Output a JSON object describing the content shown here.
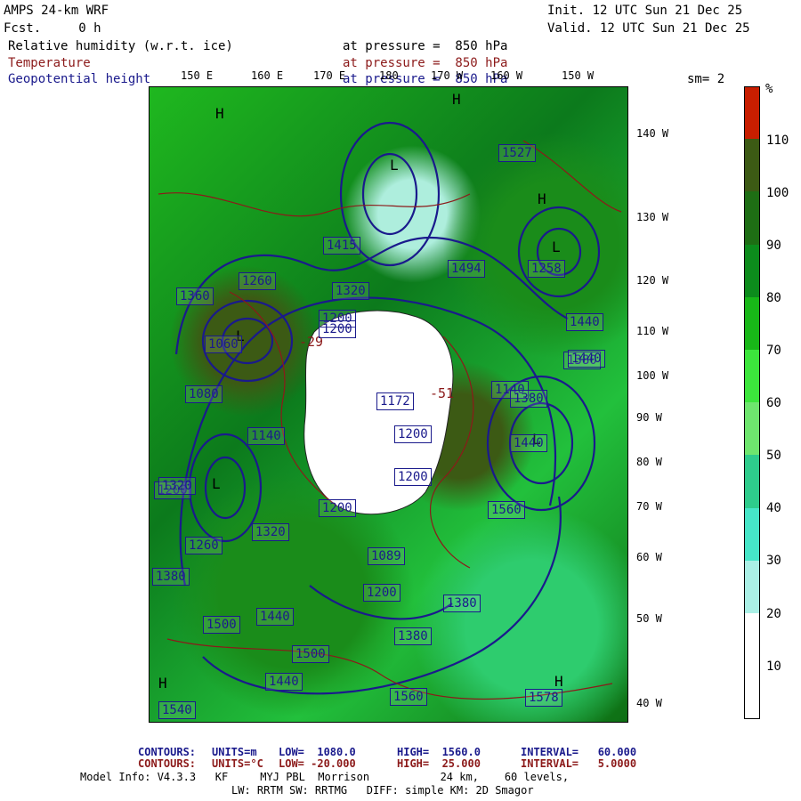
{
  "header": {
    "model": "AMPS 24-km WRF",
    "forecast": "Fcst.     0 h",
    "init": "Init. 12 UTC Sun 21 Dec 25",
    "valid": "Valid. 12 UTC Sun 21 Dec 25",
    "fields": [
      {
        "name": "Relative humidity (w.r.t. ice)",
        "level": "at pressure =  850 hPa",
        "color": "#000000"
      },
      {
        "name": "Temperature",
        "level": "at pressure =  850 hPa",
        "color": "#8c1a1a"
      },
      {
        "name": "Geopotential height",
        "level": "at pressure =  850 hPa",
        "color": "#1a1a8c"
      }
    ],
    "smoothing": "sm= 2"
  },
  "longitude_labels": [
    "150 E",
    "160 E",
    "170 E",
    "180",
    "170 W",
    "160 W",
    "150 W"
  ],
  "latitude_labels": [
    "140 W",
    "130 W",
    "120 W",
    "110 W",
    "100 W",
    "90 W",
    "80 W",
    "70 W",
    "60 W",
    "50 W",
    "40 W"
  ],
  "colorbar": {
    "unit": "%",
    "labels": [
      "110",
      "100",
      "90",
      "80",
      "70",
      "60",
      "50",
      "40",
      "30",
      "20",
      "10"
    ],
    "colors": [
      "#c81e00",
      "#3c5a14",
      "#1e6e14",
      "#0c8c1c",
      "#18b818",
      "#3ce63c",
      "#6ee66e",
      "#2ecc8c",
      "#46e6c8",
      "#aaf0e6",
      "#ffffff",
      "#ffffff"
    ]
  },
  "map_labels": {
    "height_values": [
      "1527",
      "1494",
      "1258",
      "1440",
      "1380",
      "1415",
      "1320",
      "1200",
      "1260",
      "1060",
      "1172",
      "1200",
      "1200",
      "1200",
      "1140",
      "1140",
      "1080",
      "1200",
      "1320",
      "1089",
      "1200",
      "1560",
      "1440",
      "1380",
      "1500",
      "1500",
      "1380",
      "1440",
      "1560",
      "1540",
      "1380",
      "1440",
      "1578",
      "1200",
      "1260",
      "1320",
      "1360",
      "1380",
      "1440"
    ],
    "temperature_values": [
      "-29",
      "-51"
    ],
    "highs": [
      "H",
      "H",
      "H",
      "H",
      "H"
    ],
    "lows": [
      "L",
      "L",
      "L",
      "L",
      "L"
    ]
  },
  "footer": {
    "contours_height": {
      "label": "CONTOURS:",
      "units": "UNITS=m",
      "low": "LOW=  1080.0",
      "high": "HIGH=  1560.0",
      "interval": "INTERVAL=   60.000"
    },
    "contours_temp": {
      "label": "CONTOURS:",
      "units": "UNITS=°C",
      "low": "LOW= -20.000",
      "high": "HIGH=  25.000",
      "interval": "INTERVAL=   5.0000"
    },
    "model_info_1": "Model Info: V4.3.3   KF     MYJ PBL  Morrison           24 km,    60 levels,",
    "model_info_2": "LW: RRTM SW: RRTMG   DIFF: simple KM: 2D Smagor"
  }
}
